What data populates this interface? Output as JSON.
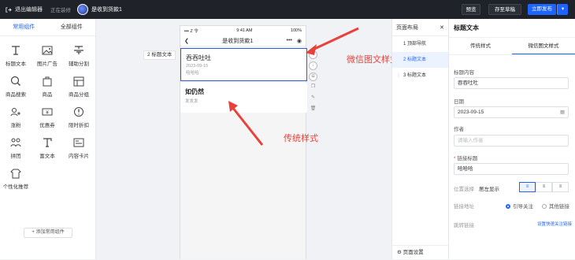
{
  "topbar": {
    "exit": "退出编辑器",
    "editing": "正在装修",
    "shop": "是收到货款1",
    "preview": "预览",
    "save_draft": "存至草稿",
    "publish": "立即发布",
    "more": "▾"
  },
  "left": {
    "tabs": [
      "常用组件",
      "全部组件"
    ],
    "components": [
      {
        "label": "标题文本",
        "icon": "title-text-icon"
      },
      {
        "label": "图片广告",
        "icon": "image-ad-icon"
      },
      {
        "label": "辅助分割",
        "icon": "divider-icon"
      },
      {
        "label": "商品搜索",
        "icon": "search-icon"
      },
      {
        "label": "商品",
        "icon": "product-icon"
      },
      {
        "label": "商品分组",
        "icon": "product-group-icon"
      },
      {
        "label": "涨粉",
        "icon": "add-fans-icon"
      },
      {
        "label": "优惠券",
        "icon": "coupon-icon"
      },
      {
        "label": "限时折扣",
        "icon": "discount-icon"
      },
      {
        "label": "拼团",
        "icon": "group-buy-icon"
      },
      {
        "label": "富文本",
        "icon": "rich-text-icon"
      },
      {
        "label": "内容卡片",
        "icon": "content-card-icon"
      },
      {
        "label": "个性化推荐",
        "icon": "recommend-icon"
      }
    ],
    "add_common": "+ 添加常用组件"
  },
  "phone": {
    "status_left": "▪▪▪ Z 令",
    "status_time": "9:41 AM",
    "status_right": "100%",
    "nav_title": "是收到货款1",
    "card1_title": "吞吞吐吐",
    "card1_date": "2023-09-15",
    "card1_author": "哈哈哈",
    "card2_title": "如仍然",
    "card2_sub": "发发发"
  },
  "component_label": "2 标题文本",
  "annotations": {
    "wechat": "微信图文样式",
    "traditional": "传统样式"
  },
  "layout": {
    "title": "页面布局",
    "items": [
      "1 顶部导航",
      "2 标题文本",
      "3 标题文本"
    ],
    "footer": "页面设置"
  },
  "right": {
    "title": "标题文本",
    "tabs": [
      "传统样式",
      "微信图文样式"
    ],
    "content_label": "标题内容",
    "content_value": "吞吞吐吐",
    "date_label": "日期",
    "date_value": "2023-09-15",
    "author_label": "作者",
    "author_placeholder": "请输入作者",
    "link_title_label": "链接标题",
    "link_title_value": "哈哈哈",
    "position_label": "位置选择",
    "position_value": "居左显示",
    "link_addr_label": "链接地址",
    "radio_follow": "引导关注",
    "radio_other": "其他链接",
    "jump_label": "跳转链接",
    "quick_setting": "设置快速关注链接"
  },
  "colors": {
    "accent": "#1e65ff",
    "annotation": "#e8403a",
    "topbar": "#1f2329"
  }
}
